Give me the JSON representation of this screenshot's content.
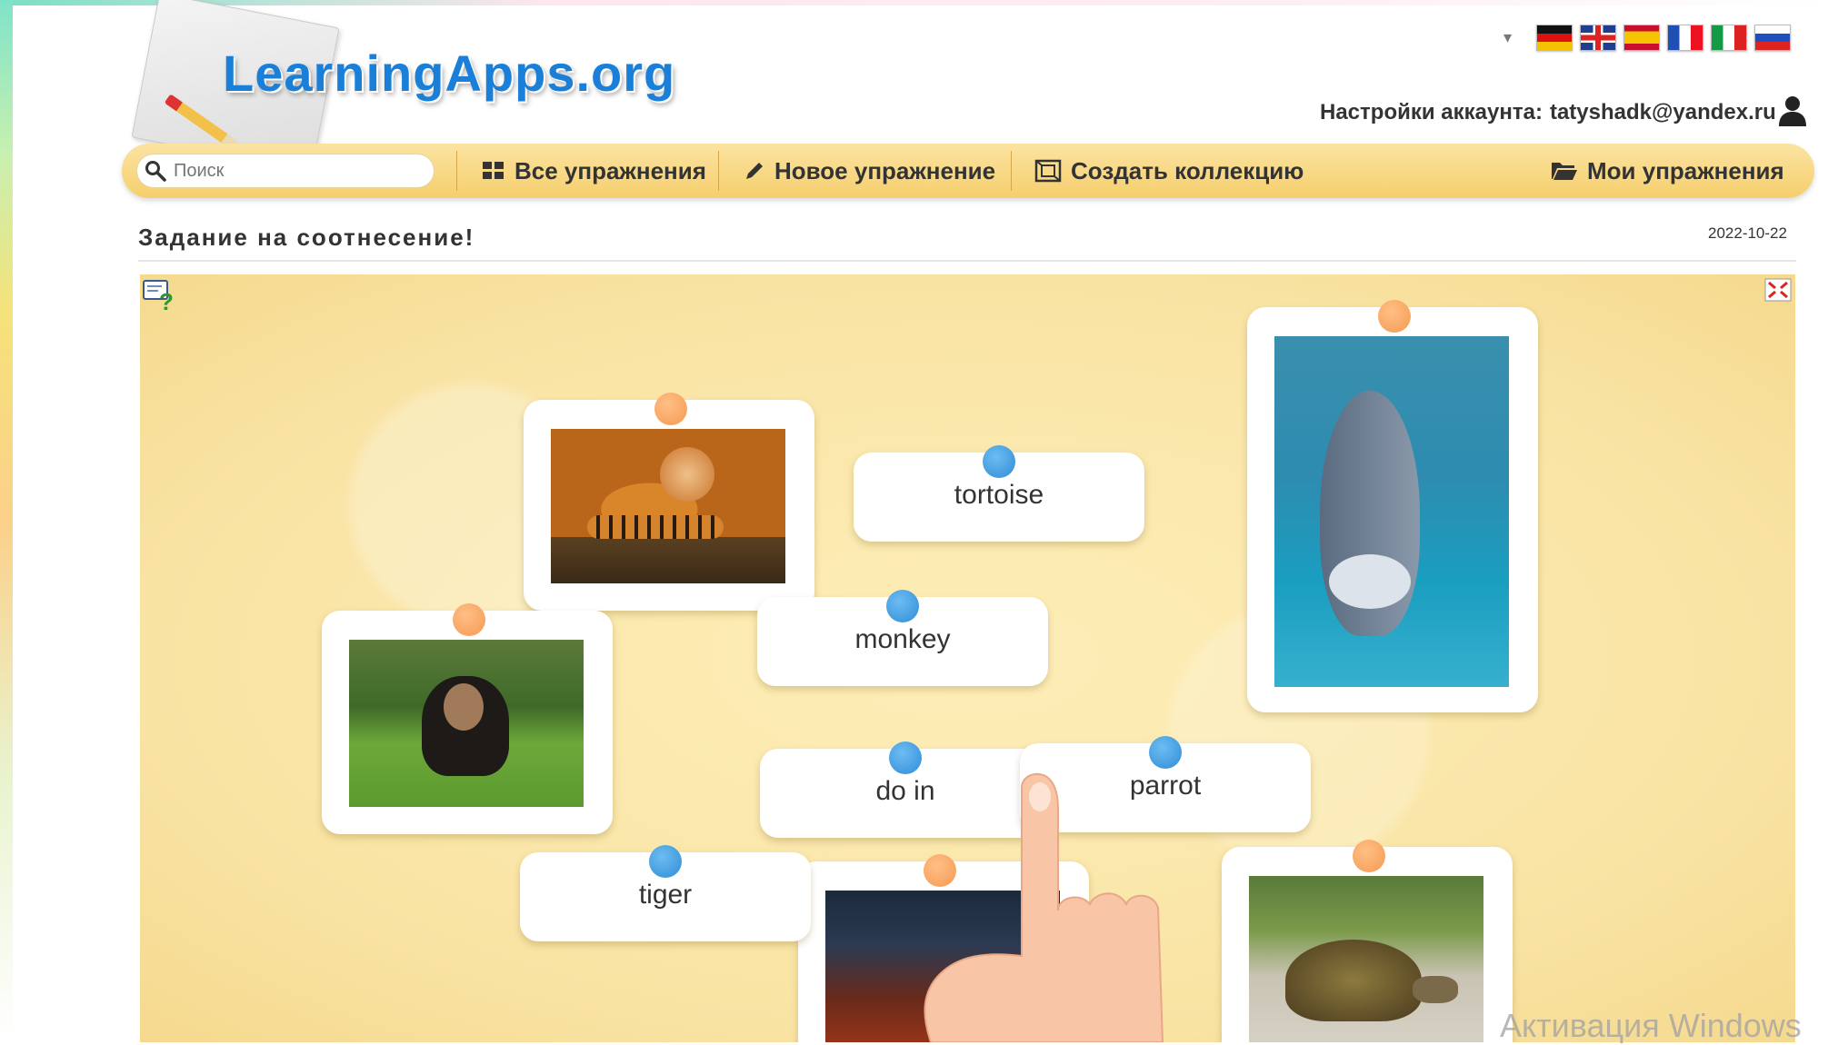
{
  "header": {
    "logo_text": "LearningApps.org",
    "account_label": "Настройки аккаунта:",
    "account_email": "tatyshadk@yandex.ru",
    "languages": [
      "de",
      "en",
      "es",
      "fr",
      "it",
      "ru"
    ]
  },
  "nav": {
    "search_placeholder": "Поиск",
    "all_exercises": "Все упражнения",
    "new_exercise": "Новое упражнение",
    "create_collection": "Создать коллекцию",
    "my_exercises": "Мои упражнения"
  },
  "page": {
    "title": "Задание на соотнесение!",
    "date": "2022-10-22"
  },
  "app": {
    "words": {
      "tortoise": "tortoise",
      "monkey": "monkey",
      "dolphin": "do in",
      "parrot": "parrot",
      "tiger": "tiger"
    },
    "images": [
      "tiger",
      "monkey",
      "dolphin",
      "parrot",
      "tortoise"
    ]
  },
  "watermark": "Активация Windows",
  "colors": {
    "nav": "#f6cf6d",
    "logo": "#1a7fd8",
    "board": "#f9e3a3",
    "pin_orange": "#f49a50",
    "pin_blue": "#2f8dd6"
  }
}
